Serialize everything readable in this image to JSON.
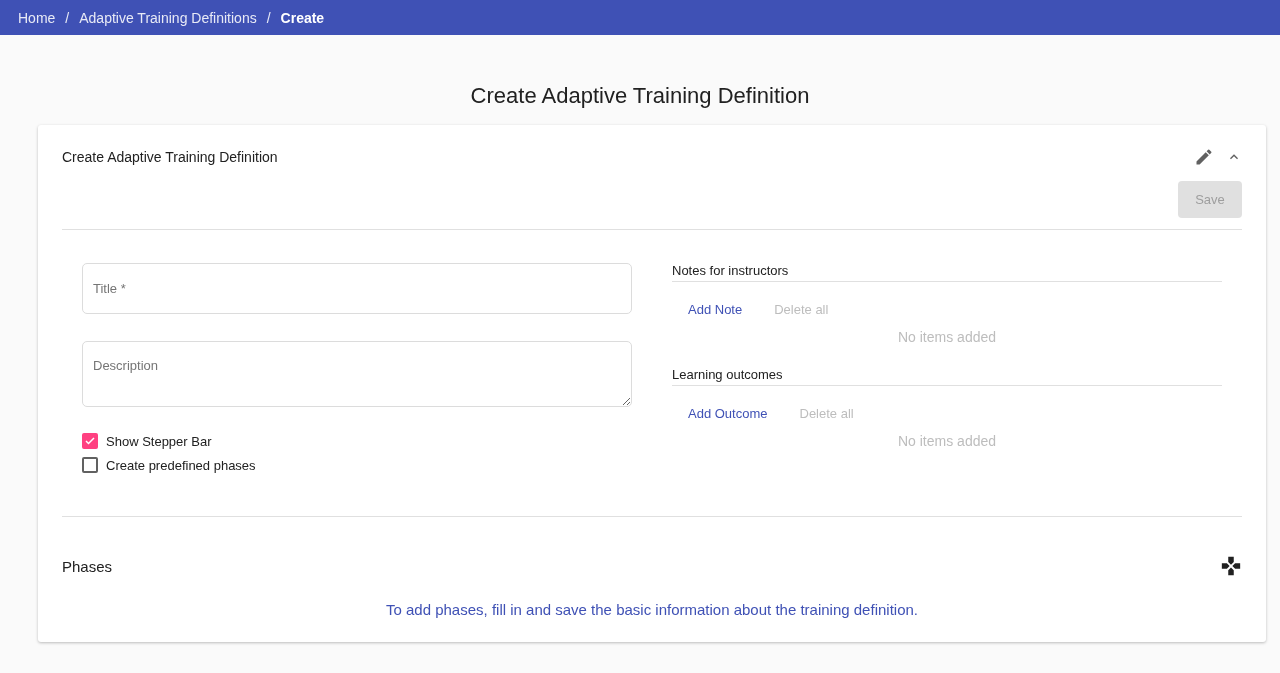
{
  "breadcrumbs": {
    "separator": "/",
    "items": [
      {
        "label": "Home",
        "current": false
      },
      {
        "label": "Adaptive Training Definitions",
        "current": false
      },
      {
        "label": "Create",
        "current": true
      }
    ]
  },
  "page_title": "Create Adaptive Training Definition",
  "card": {
    "title": "Create Adaptive Training Definition",
    "expanded": true,
    "save_button": {
      "label": "Save",
      "disabled": true
    },
    "fields": [
      {
        "kind": "input",
        "placeholder": "Title *"
      },
      {
        "kind": "textarea",
        "placeholder": "Description"
      }
    ],
    "checkboxes": [
      {
        "label": "Show Stepper Bar",
        "checked": true
      },
      {
        "label": "Create predefined phases",
        "checked": false
      }
    ],
    "lists": [
      {
        "title": "Notes for instructors",
        "add_label": "Add Note",
        "delete_label": "Delete all",
        "delete_disabled": true,
        "empty_text": "No items added"
      },
      {
        "title": "Learning outcomes",
        "add_label": "Add Outcome",
        "delete_label": "Delete all",
        "delete_disabled": true,
        "empty_text": "No items added"
      }
    ],
    "phases": {
      "title": "Phases",
      "message": "To add phases, fill in and save the basic information about the training definition."
    }
  }
}
